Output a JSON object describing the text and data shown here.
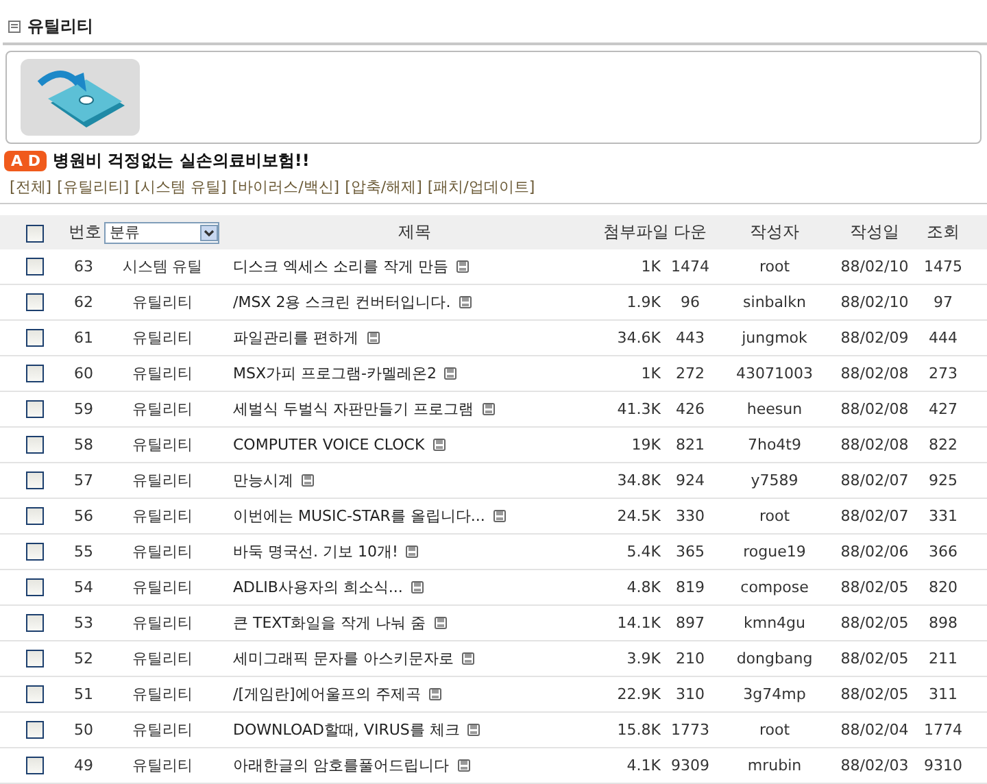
{
  "section": {
    "title": "유틸리티"
  },
  "ad": {
    "badge": "A D",
    "text": "병원비 걱정없는 실손의료비보험!!"
  },
  "categories": [
    "[전체]",
    "[유틸리티]",
    "[시스템 유틸]",
    "[바이러스/백신]",
    "[압축/해제]",
    "[패치/업데이트]"
  ],
  "table": {
    "header": {
      "checked": false,
      "number": "번호",
      "category_select": "분류",
      "title": "제목",
      "attachment": "첨부파일",
      "downloads": "다운",
      "author": "작성자",
      "date": "작성일",
      "views": "조회"
    },
    "rows": [
      {
        "checked": false,
        "number": "63",
        "category": "시스템 유틸",
        "title": "디스크 엑세스 소리를 작게 만듬",
        "attachment": "1K",
        "downloads": "1474",
        "author": "root",
        "date": "88/02/10",
        "views": "1475"
      },
      {
        "checked": false,
        "number": "62",
        "category": "유틸리티",
        "title": "/MSX 2용 스크린 컨버터입니다.",
        "attachment": "1.9K",
        "downloads": "96",
        "author": "sinbalkn",
        "date": "88/02/10",
        "views": "97"
      },
      {
        "checked": false,
        "number": "61",
        "category": "유틸리티",
        "title": "파일관리를 편하게",
        "attachment": "34.6K",
        "downloads": "443",
        "author": "jungmok",
        "date": "88/02/09",
        "views": "444"
      },
      {
        "checked": false,
        "number": "60",
        "category": "유틸리티",
        "title": "MSX가피 프로그램-카멜레온2",
        "attachment": "1K",
        "downloads": "272",
        "author": "43071003",
        "date": "88/02/08",
        "views": "273"
      },
      {
        "checked": false,
        "number": "59",
        "category": "유틸리티",
        "title": "세벌식 두벌식 자판만들기 프로그램",
        "attachment": "41.3K",
        "downloads": "426",
        "author": "heesun",
        "date": "88/02/08",
        "views": "427"
      },
      {
        "checked": false,
        "number": "58",
        "category": "유틸리티",
        "title": "COMPUTER VOICE CLOCK",
        "attachment": "19K",
        "downloads": "821",
        "author": "7ho4t9",
        "date": "88/02/08",
        "views": "822"
      },
      {
        "checked": false,
        "number": "57",
        "category": "유틸리티",
        "title": "만능시계",
        "attachment": "34.8K",
        "downloads": "924",
        "author": "y7589",
        "date": "88/02/07",
        "views": "925"
      },
      {
        "checked": false,
        "number": "56",
        "category": "유틸리티",
        "title": "이번에는 MUSIC-STAR를 올립니다...",
        "attachment": "24.5K",
        "downloads": "330",
        "author": "root",
        "date": "88/02/07",
        "views": "331"
      },
      {
        "checked": false,
        "number": "55",
        "category": "유틸리티",
        "title": "바둑 명국선. 기보 10개!",
        "attachment": "5.4K",
        "downloads": "365",
        "author": "rogue19",
        "date": "88/02/06",
        "views": "366"
      },
      {
        "checked": false,
        "number": "54",
        "category": "유틸리티",
        "title": "ADLIB사용자의 희소식...",
        "attachment": "4.8K",
        "downloads": "819",
        "author": "compose",
        "date": "88/02/05",
        "views": "820"
      },
      {
        "checked": false,
        "number": "53",
        "category": "유틸리티",
        "title": "큰 TEXT화일을 작게 나눠 줌",
        "attachment": "14.1K",
        "downloads": "897",
        "author": "kmn4gu",
        "date": "88/02/05",
        "views": "898"
      },
      {
        "checked": false,
        "number": "52",
        "category": "유틸리티",
        "title": "세미그래픽 문자를 아스키문자로",
        "attachment": "3.9K",
        "downloads": "210",
        "author": "dongbang",
        "date": "88/02/05",
        "views": "211"
      },
      {
        "checked": false,
        "number": "51",
        "category": "유틸리티",
        "title": "/[게임란]에어울프의 주제곡",
        "attachment": "22.9K",
        "downloads": "310",
        "author": "3g74mp",
        "date": "88/02/05",
        "views": "311"
      },
      {
        "checked": false,
        "number": "50",
        "category": "유틸리티",
        "title": "DOWNLOAD할때, VIRUS를 체크",
        "attachment": "15.8K",
        "downloads": "1773",
        "author": "root",
        "date": "88/02/04",
        "views": "1774"
      },
      {
        "checked": false,
        "number": "49",
        "category": "유틸리티",
        "title": "아래한글의 암호를풀어드립니다",
        "attachment": "4.1K",
        "downloads": "9309",
        "author": "mrubin",
        "date": "88/02/03",
        "views": "9310"
      }
    ]
  }
}
